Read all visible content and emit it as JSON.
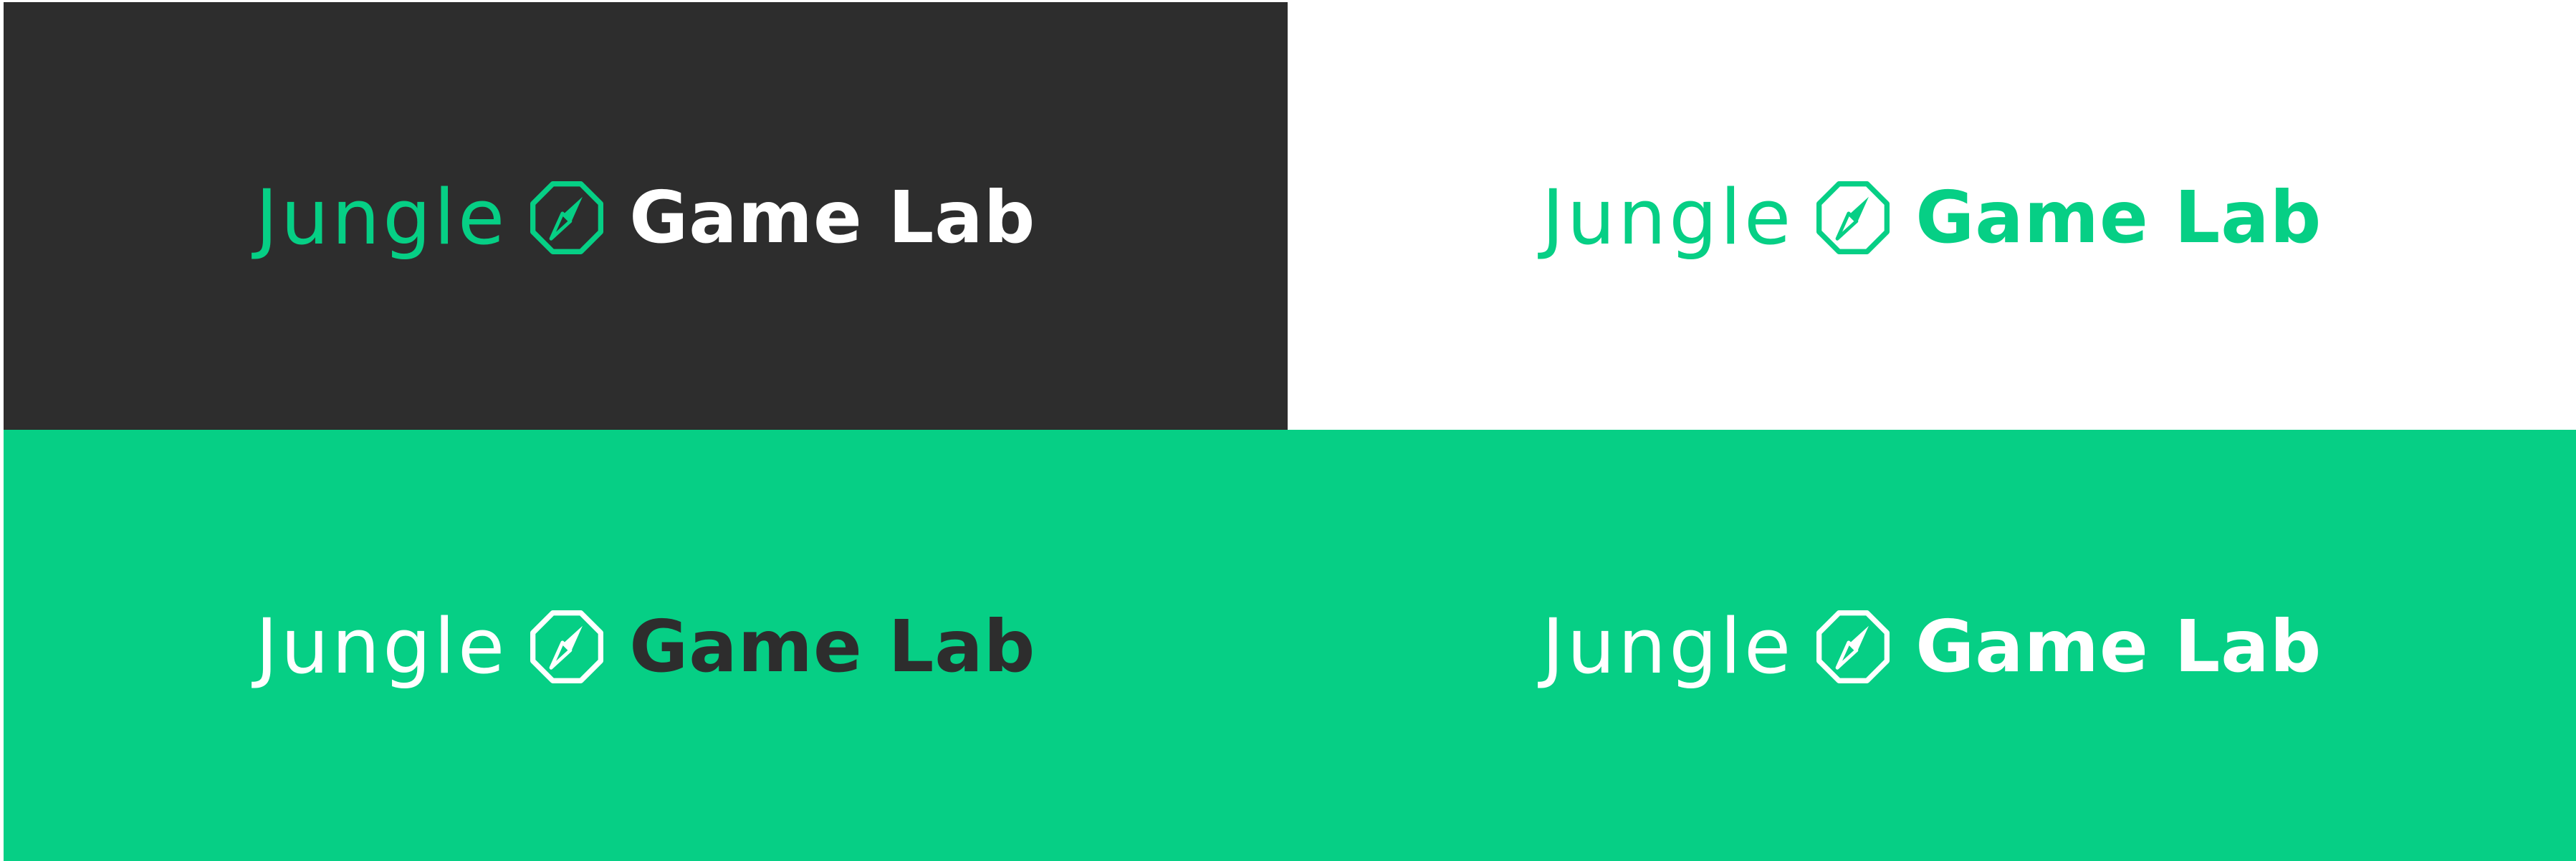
{
  "brand": {
    "word1": "Jungle",
    "word2": "Game Lab",
    "emblem_icon": "compass-icon"
  },
  "colors": {
    "dark": "#2d2d2d",
    "green": "#06cf85",
    "white": "#ffffff"
  },
  "variants": [
    {
      "background": "#2d2d2d",
      "word1_color": "#06cf85",
      "emblem_color": "#06cf85",
      "word2_color": "#ffffff"
    },
    {
      "background": "#ffffff",
      "word1_color": "#06cf85",
      "emblem_color": "#06cf85",
      "word2_color": "#06cf85"
    },
    {
      "background": "#06cf85",
      "word1_color": "#ffffff",
      "emblem_color": "#ffffff",
      "word2_color": "#2d2d2d"
    },
    {
      "background": "#06cf85",
      "word1_color": "#ffffff",
      "emblem_color": "#ffffff",
      "word2_color": "#ffffff"
    }
  ]
}
